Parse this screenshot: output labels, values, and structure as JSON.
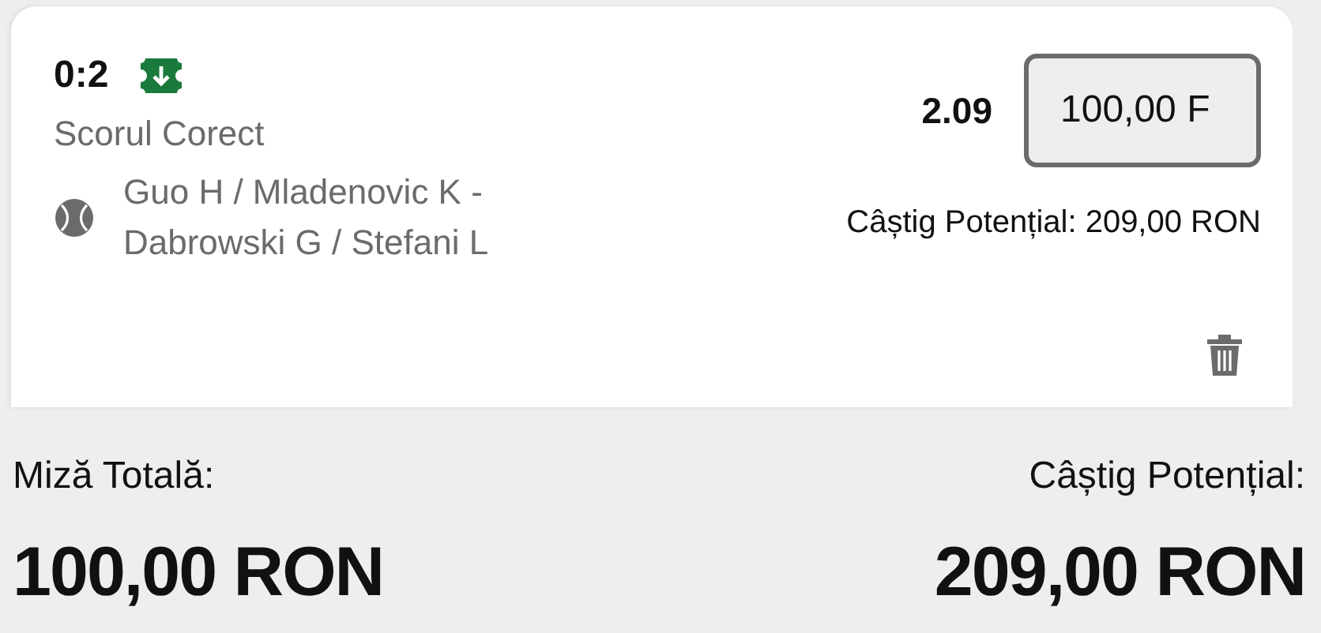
{
  "bet": {
    "score": "0:2",
    "market": "Scorul Corect",
    "event": "Guo H / Mladenovic K - Dabrowski G / Stefani L",
    "odds": "2.09",
    "stake": "100,00 F",
    "potential": "Câștig Potențial: 209,00 RON"
  },
  "summary": {
    "stake_label": "Miză Totală:",
    "stake_value": "100,00 RON",
    "win_label": "Câștig Potențial:",
    "win_value": "209,00 RON"
  }
}
